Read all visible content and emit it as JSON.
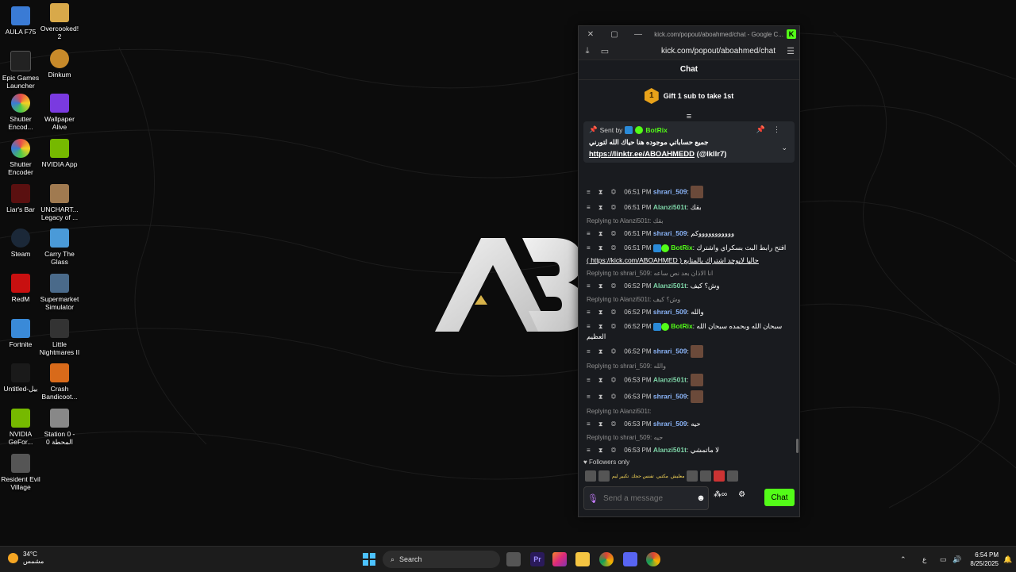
{
  "desktop": {
    "icons": [
      {
        "label": "AULA F75",
        "color": "#3a7bd5"
      },
      {
        "label": "Overcooked! 2",
        "color": "#d8a94a"
      },
      {
        "label": "Epic Games Launcher",
        "color": "#222222"
      },
      {
        "label": "Dinkum",
        "color": "#c88a2a"
      },
      {
        "label": "Shutter Encod...",
        "color": "#e84a4a"
      },
      {
        "label": "Wallpaper Alive",
        "color": "#7a3ae0"
      },
      {
        "label": "Shutter Encoder",
        "color": "#e84a4a"
      },
      {
        "label": "NVIDIA App",
        "color": "#76b900"
      },
      {
        "label": "Liar's Bar",
        "color": "#5a1010"
      },
      {
        "label": "UNCHART... Legacy of ...",
        "color": "#a07a50"
      },
      {
        "label": "Steam",
        "color": "#1b2838"
      },
      {
        "label": "Carry The Glass",
        "color": "#4a9ad8"
      },
      {
        "label": "RedM",
        "color": "#c81010"
      },
      {
        "label": "Supermarket Simulator",
        "color": "#4a6a8a"
      },
      {
        "label": "Fortnite",
        "color": "#3a8ad8"
      },
      {
        "label": "Little Nightmares II",
        "color": "#333333"
      },
      {
        "label": "Untitled-بيل",
        "color": "#1a1a1a"
      },
      {
        "label": "Crash Bandicoot...",
        "color": "#d86a1a"
      },
      {
        "label": "NVIDIA GeFor...",
        "color": "#76b900"
      },
      {
        "label": "Station 0 - المحطة 0",
        "color": "#888888"
      },
      {
        "label": "Resident Evil Village",
        "color": "#555555"
      }
    ]
  },
  "window": {
    "title": "kick.com/popout/aboahmed/chat - Google C...",
    "url": "kick.com/popout/aboahmed/chat",
    "close": "✕",
    "maximize": "▢",
    "minimize": "—",
    "kick_logo": "K"
  },
  "chat": {
    "header": "Chat",
    "gift": {
      "rank": "1",
      "text": "Gift 1 sub to take 1st"
    },
    "pinned": {
      "sent_by": "Sent by",
      "bot": "BotRix",
      "text": "جميع حساباتي موجوده هنا حياك الله لتورني",
      "link": "https://linktr.ee/ABOAHMEDD",
      "handle": "(@lkllr7)"
    },
    "messages": [
      {
        "type": "msg",
        "time": "06:51 PM",
        "user": "shrari_509",
        "user_color": "blue",
        "text": "",
        "avatar": true
      },
      {
        "type": "msg",
        "time": "06:51 PM",
        "user": "Alanzi501t",
        "user_color": "green",
        "text": "بقك"
      },
      {
        "type": "reply",
        "text": "Replying to Alanzi501t: بقك"
      },
      {
        "type": "msg",
        "time": "06:51 PM",
        "user": "shrari_509",
        "user_color": "blue",
        "text": "وووووووووووكم"
      },
      {
        "type": "msg",
        "time": "06:51 PM",
        "user": "BotRix",
        "user_color": "bot",
        "text": "افتح رابط البث بسكراي واشترك",
        "extra": "( https://kick.com/ABOAHMED ) حاليا لايوجد اشتراك بالمتابع"
      },
      {
        "type": "reply",
        "text": "Replying to shrari_509: انا الاذان بعد نص ساعه"
      },
      {
        "type": "msg",
        "time": "06:52 PM",
        "user": "Alanzi501t",
        "user_color": "green",
        "text": "وش؟ كيف"
      },
      {
        "type": "reply",
        "text": "Replying to Alanzi501t: وش؟ كيف"
      },
      {
        "type": "msg",
        "time": "06:52 PM",
        "user": "shrari_509",
        "user_color": "blue",
        "text": "والله"
      },
      {
        "type": "msg",
        "time": "06:52 PM",
        "user": "BotRix",
        "user_color": "bot",
        "text": "سبحان الله وبحمده سبحان الله العظيم"
      },
      {
        "type": "msg",
        "time": "06:52 PM",
        "user": "shrari_509",
        "user_color": "blue",
        "text": "",
        "avatar": true
      },
      {
        "type": "reply",
        "text": "Replying to shrari_509: والله"
      },
      {
        "type": "msg",
        "time": "06:53 PM",
        "user": "Alanzi501t",
        "user_color": "green",
        "text": "",
        "avatar": true
      },
      {
        "type": "msg",
        "time": "06:53 PM",
        "user": "shrari_509",
        "user_color": "blue",
        "text": "",
        "avatar": true
      },
      {
        "type": "reply",
        "text": "Replying to Alanzi501t:"
      },
      {
        "type": "msg",
        "time": "06:53 PM",
        "user": "shrari_509",
        "user_color": "blue",
        "text": "حيه"
      },
      {
        "type": "reply",
        "text": "Replying to shrari_509: حيه"
      },
      {
        "type": "msg",
        "time": "06:53 PM",
        "user": "Alanzi501t",
        "user_color": "green",
        "text": "لا ماتمشي"
      }
    ],
    "followers_only": "Followers only",
    "emote_texts": [
      "تكبير ليم",
      "تفنس حجك",
      "مكتبي",
      "معليش"
    ],
    "input_placeholder": "Send a message",
    "chat_button": "Chat",
    "infinity": "∞"
  },
  "taskbar": {
    "weather_temp": "34°C",
    "weather_desc": "مشمس",
    "search_label": "Search",
    "lang": "ع",
    "time": "6:54 PM",
    "date": "8/25/2025"
  }
}
